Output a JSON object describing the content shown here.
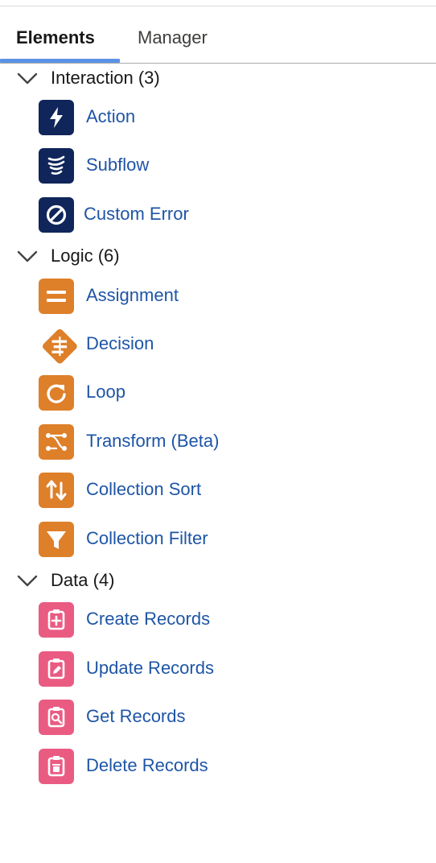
{
  "tabs": [
    {
      "label": "Elements",
      "selected": true
    },
    {
      "label": "Manager",
      "selected": false
    }
  ],
  "sections": [
    {
      "label": "Interaction (3)",
      "color": "#10255a",
      "items": [
        {
          "label": "Action",
          "icon": "lightning-icon"
        },
        {
          "label": "Subflow",
          "icon": "subflow-icon"
        },
        {
          "label": "Custom Error",
          "icon": "prohibited-icon"
        }
      ]
    },
    {
      "label": "Logic (6)",
      "color": "#de7f29",
      "items": [
        {
          "label": "Assignment",
          "icon": "equals-icon"
        },
        {
          "label": "Decision",
          "icon": "signpost-icon"
        },
        {
          "label": "Loop",
          "icon": "refresh-icon"
        },
        {
          "label": "Transform (Beta)",
          "icon": "transform-icon"
        },
        {
          "label": "Collection Sort",
          "icon": "sort-arrows-icon"
        },
        {
          "label": "Collection Filter",
          "icon": "funnel-icon"
        }
      ]
    },
    {
      "label": "Data (4)",
      "color": "#ea5b82",
      "items": [
        {
          "label": "Create Records",
          "icon": "record-create-icon"
        },
        {
          "label": "Update Records",
          "icon": "record-update-icon"
        },
        {
          "label": "Get Records",
          "icon": "record-lookup-icon"
        },
        {
          "label": "Delete Records",
          "icon": "record-delete-icon"
        }
      ]
    }
  ]
}
